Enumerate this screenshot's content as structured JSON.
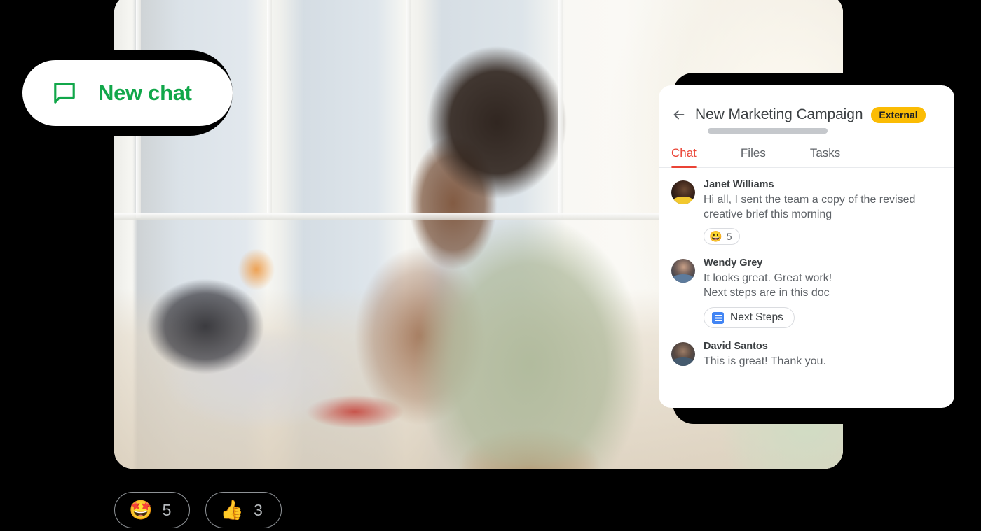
{
  "new_chat_button": {
    "label": "New chat",
    "icon": "chat-bubble-icon",
    "text_color": "#11A74A"
  },
  "photo": {
    "alt": "Person sitting at a sunlit desk working on a laptop during a video call"
  },
  "chat_panel": {
    "back_icon": "back-arrow-icon",
    "title": "New Marketing Campaign",
    "badge": "External",
    "badge_color": "#FBBC04",
    "accent_color": "#EA4335",
    "tabs": [
      {
        "label": "Chat",
        "active": true
      },
      {
        "label": "Files",
        "active": false
      },
      {
        "label": "Tasks",
        "active": false
      }
    ],
    "messages": [
      {
        "author": "Janet Williams",
        "avatar": "avatar-janet-williams",
        "lines": [
          "Hi all, I sent the team a copy of the revised",
          "creative brief this morning"
        ],
        "reaction": {
          "emoji": "😃",
          "count": "5"
        }
      },
      {
        "author": "Wendy Grey",
        "avatar": "avatar-wendy-grey",
        "lines": [
          "It looks great. Great work!",
          "Next steps are in this doc"
        ],
        "attachment": {
          "icon": "google-docs-icon",
          "label": "Next Steps",
          "icon_color": "#4285F4"
        }
      },
      {
        "author": "David Santos",
        "avatar": "avatar-david-santos",
        "lines": [
          "This is great! Thank you."
        ]
      }
    ]
  },
  "bottom_reactions": [
    {
      "emoji": "🤩",
      "name": "star-struck-emoji",
      "count": "5"
    },
    {
      "emoji": "👍",
      "name": "thumbs-up-emoji",
      "count": "3"
    }
  ]
}
